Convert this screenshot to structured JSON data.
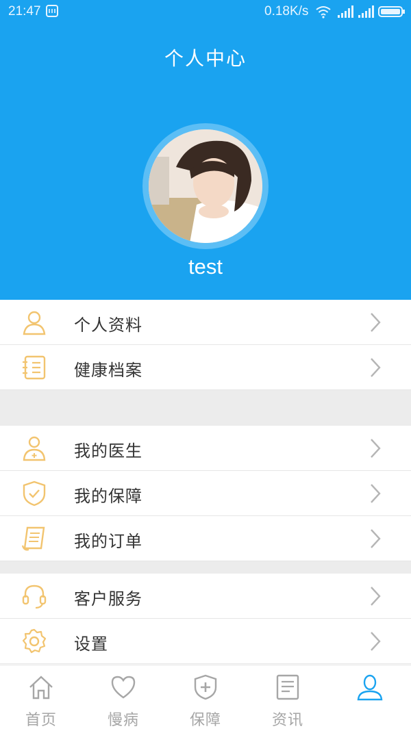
{
  "status_bar": {
    "time": "21:47",
    "net_speed": "0.18K/s",
    "icons": [
      "notification-icon",
      "wifi-icon",
      "signal-icon",
      "signal-icon",
      "battery-icon"
    ]
  },
  "header": {
    "title": "个人中心",
    "username": "test"
  },
  "menu": {
    "group1": [
      {
        "label": "个人资料",
        "icon": "user-icon"
      },
      {
        "label": "健康档案",
        "icon": "health-record-icon"
      }
    ],
    "group2": [
      {
        "label": "我的医生",
        "icon": "doctor-icon"
      },
      {
        "label": "我的保障",
        "icon": "shield-icon"
      },
      {
        "label": "我的订单",
        "icon": "order-icon"
      }
    ],
    "group3": [
      {
        "label": "客户服务",
        "icon": "headset-icon"
      },
      {
        "label": "设置",
        "icon": "settings-icon"
      }
    ]
  },
  "tab_bar": {
    "tabs": [
      {
        "label": "首页",
        "icon": "home-icon",
        "active": false
      },
      {
        "label": "慢病",
        "icon": "heart-icon",
        "active": false
      },
      {
        "label": "保障",
        "icon": "shield-plus-icon",
        "active": false
      },
      {
        "label": "资讯",
        "icon": "news-icon",
        "active": false
      },
      {
        "label": "",
        "icon": "profile-icon",
        "active": true
      }
    ]
  },
  "colors": {
    "primary": "#1aa3f0",
    "menu_icon": "#f2c46f",
    "tab_inactive": "#a6a6a6",
    "gap": "#ececec"
  }
}
